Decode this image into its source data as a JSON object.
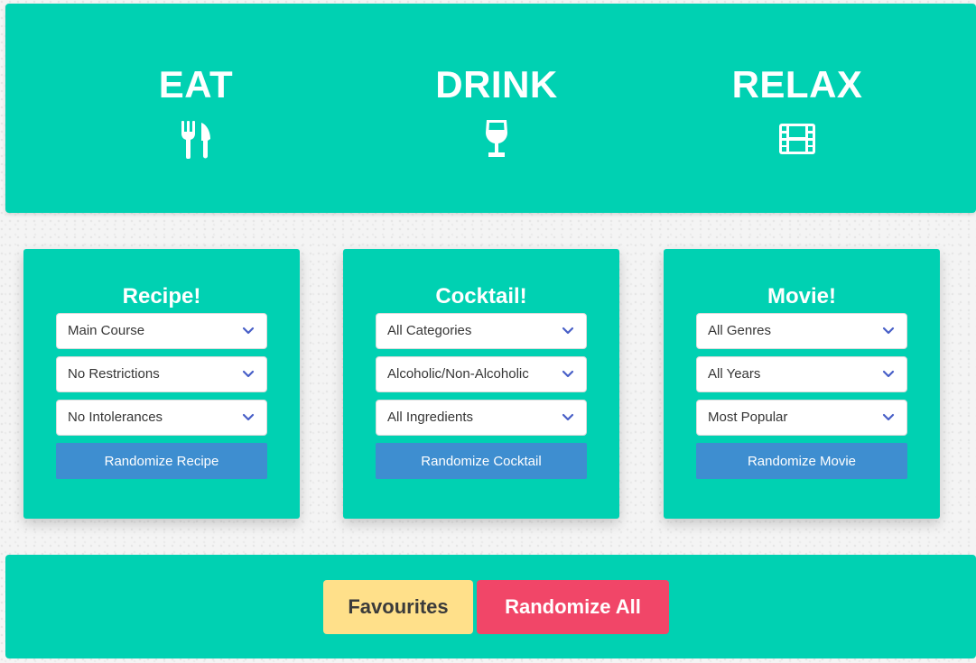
{
  "colors": {
    "primary": "#00d1b2",
    "button_blue": "#3e8ed0",
    "favourites_yellow": "#ffe08a",
    "randomize_all_red": "#f14668",
    "chevron": "#485fc7"
  },
  "hero": {
    "columns": [
      {
        "title": "EAT",
        "icon": "utensils-icon"
      },
      {
        "title": "DRINK",
        "icon": "wine-glass-icon"
      },
      {
        "title": "RELAX",
        "icon": "film-icon"
      }
    ]
  },
  "cards": [
    {
      "title": "Recipe!",
      "selects": [
        "Main Course",
        "No Restrictions",
        "No Intolerances"
      ],
      "button": "Randomize Recipe"
    },
    {
      "title": "Cocktail!",
      "selects": [
        "All Categories",
        "Alcoholic/Non-Alcoholic",
        "All Ingredients"
      ],
      "button": "Randomize Cocktail"
    },
    {
      "title": "Movie!",
      "selects": [
        "All Genres",
        "All Years",
        "Most Popular"
      ],
      "button": "Randomize Movie"
    }
  ],
  "footer": {
    "favourites_label": "Favourites",
    "randomize_all_label": "Randomize All"
  }
}
